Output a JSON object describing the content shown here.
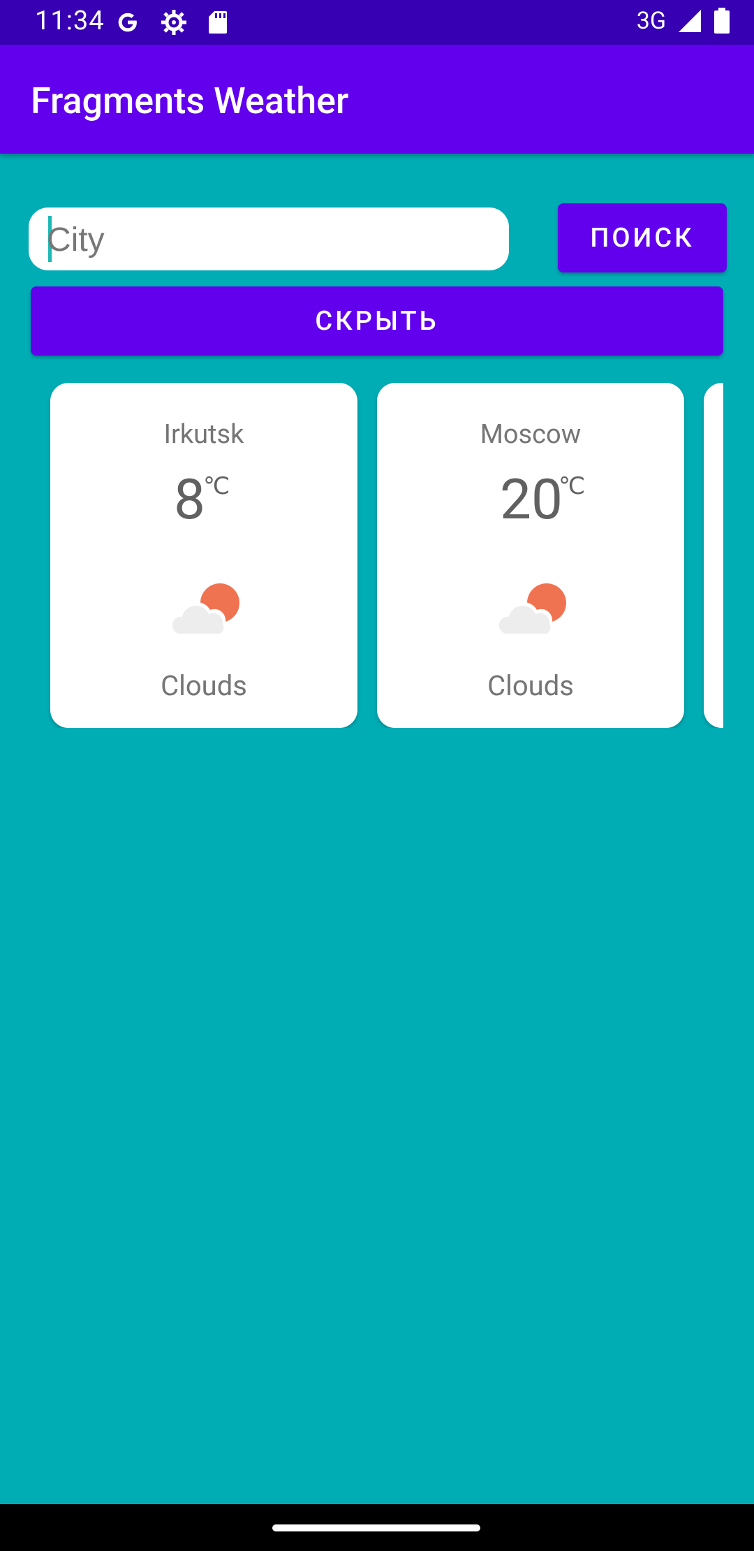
{
  "status_bar": {
    "time": "11:34",
    "network": "3G",
    "icons_left": [
      "google-icon",
      "settings-gear-icon",
      "sd-card-icon"
    ],
    "icons_right": [
      "signal-icon",
      "battery-icon"
    ]
  },
  "app_bar": {
    "title": "Fragments Weather"
  },
  "search": {
    "placeholder": "City",
    "value": "",
    "search_label": "ПОИСК",
    "hide_label": "СКРЫТЬ"
  },
  "cards": [
    {
      "city": "Irkutsk",
      "temp": "8",
      "unit": "℃",
      "description": "Clouds",
      "icon": "cloud-sun-icon"
    },
    {
      "city": "Moscow",
      "temp": "20",
      "unit": "℃",
      "description": "Clouds",
      "icon": "cloud-sun-icon"
    }
  ],
  "colors": {
    "primary": "#6200EE",
    "primary_dark": "#3700B3",
    "background": "#00ADB5",
    "card": "#FFFFFF",
    "sun": "#F07351",
    "cloud": "#EDEDED"
  }
}
